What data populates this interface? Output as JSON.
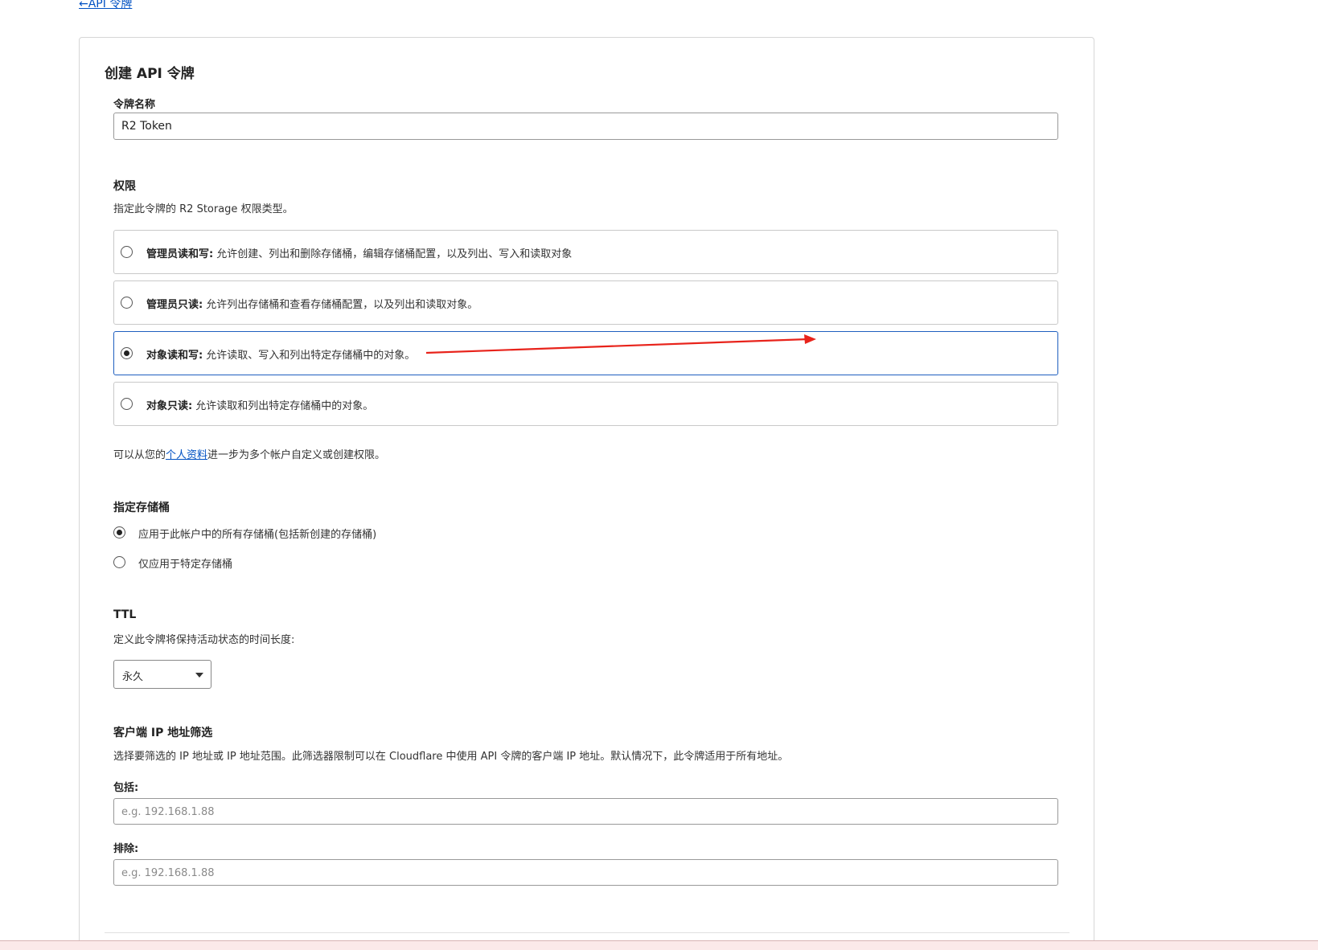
{
  "nav": {
    "back_label": "←API 令牌"
  },
  "form": {
    "title": "创建 API 令牌",
    "token_name": {
      "label": "令牌名称",
      "value": "R2 Token"
    },
    "permissions": {
      "title": "权限",
      "description": "指定此令牌的 R2 Storage 权限类型。",
      "selected_index": 2,
      "options": [
        {
          "name": "管理员读和写:",
          "description": "允许创建、列出和删除存储桶，编辑存储桶配置，以及列出、写入和读取对象"
        },
        {
          "name": "管理员只读:",
          "description": "允许列出存储桶和查看存储桶配置，以及列出和读取对象。"
        },
        {
          "name": "对象读和写:",
          "description": "允许读取、写入和列出特定存储桶中的对象。"
        },
        {
          "name": "对象只读:",
          "description": "允许读取和列出特定存储桶中的对象。"
        }
      ],
      "note_before": "可以从您的",
      "note_link": "个人资料",
      "note_after": "进一步为多个帐户自定义或创建权限。"
    },
    "buckets": {
      "title": "指定存储桶",
      "selected_index": 0,
      "options": [
        "应用于此帐户中的所有存储桶(包括新创建的存储桶)",
        "仅应用于特定存储桶"
      ]
    },
    "ttl": {
      "title": "TTL",
      "description": "定义此令牌将保持活动状态的时间长度:",
      "selected": "永久"
    },
    "ip_filter": {
      "title": "客户端 IP 地址筛选",
      "description": "选择要筛选的 IP 地址或 IP 地址范围。此筛选器限制可以在 Cloudflare 中使用 API 令牌的客户端 IP 地址。默认情况下，此令牌适用于所有地址。",
      "include_label": "包括:",
      "include_placeholder": "e.g. 192.168.1.88",
      "exclude_label": "排除:",
      "exclude_placeholder": "e.g. 192.168.1.88"
    }
  },
  "annotation": {
    "arrow_color": "#e8231b"
  }
}
